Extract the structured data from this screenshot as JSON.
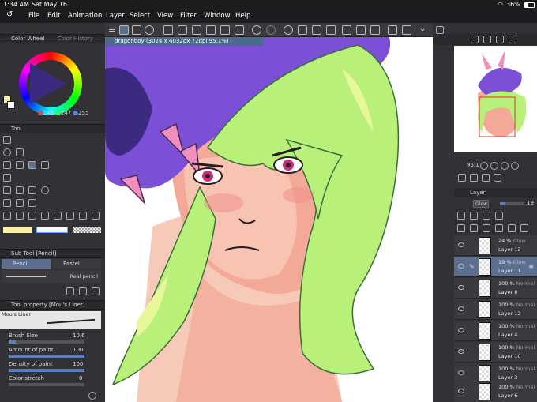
{
  "status": {
    "time": "1:34 AM",
    "date": "Sat May 16",
    "battery": "36%"
  },
  "menu": [
    "File",
    "Edit",
    "Animation",
    "Layer",
    "Select",
    "View",
    "Filter",
    "Window",
    "Help"
  ],
  "canvas": {
    "tab_title": "dragonboy (3024 x 4032px 72dpi 95.1%)"
  },
  "color_wheel": {
    "tab1": "Color Wheel",
    "tab2": "Color History",
    "r": "249",
    "g": "247",
    "b": "255"
  },
  "tool_panel": {
    "title": "Tool"
  },
  "sub_tool": {
    "title": "Sub Tool [Pencil]",
    "tab_pencil": "Pencil",
    "tab_pastel": "Pastel",
    "brush_name": "Real pencil"
  },
  "tool_property": {
    "title": "Tool property [Mou's Liner]",
    "brush_label": "Mou's Liner",
    "props": [
      {
        "label": "Brush Size",
        "value": "10.6"
      },
      {
        "label": "Amount of paint",
        "value": "100"
      },
      {
        "label": "Density of paint",
        "value": "100"
      },
      {
        "label": "Color stretch",
        "value": "0"
      }
    ]
  },
  "navigator": {
    "zoom": "95.1"
  },
  "layer_panel": {
    "title": "Layer",
    "blend": "Glow",
    "opacity": "19",
    "layers": [
      {
        "pct": "24 %",
        "mode": "Glow",
        "name": "Layer 13",
        "selected": false
      },
      {
        "pct": "19 %",
        "mode": "Glow",
        "name": "Layer 11",
        "selected": true
      },
      {
        "pct": "100 %",
        "mode": "Normal",
        "name": "Layer 8",
        "selected": false
      },
      {
        "pct": "100 %",
        "mode": "Normal",
        "name": "Layer 12",
        "selected": false
      },
      {
        "pct": "100 %",
        "mode": "Normal",
        "name": "Layer 4",
        "selected": false
      },
      {
        "pct": "100 %",
        "mode": "Normal",
        "name": "Layer 10",
        "selected": false
      },
      {
        "pct": "100 %",
        "mode": "Normal",
        "name": "Layer 3",
        "selected": false
      },
      {
        "pct": "100 %",
        "mode": "Normal",
        "name": "Layer 6",
        "selected": false
      }
    ]
  },
  "colors": {
    "accent": "#5d6f8e",
    "panel": "#323236",
    "hair": "#b8f07a",
    "skin": "#f6b9a7",
    "hat": "#7b4fd6"
  }
}
